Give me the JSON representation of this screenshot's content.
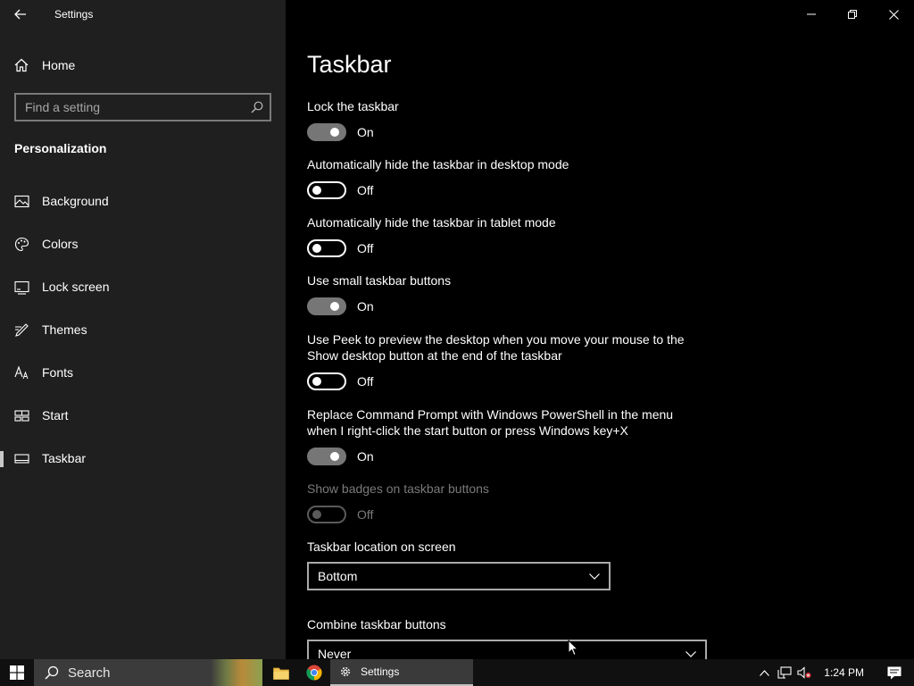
{
  "window": {
    "title": "Settings"
  },
  "sidebar": {
    "home_label": "Home",
    "search_placeholder": "Find a setting",
    "section_title": "Personalization",
    "items": [
      {
        "label": "Background",
        "icon": "image-icon"
      },
      {
        "label": "Colors",
        "icon": "palette-icon"
      },
      {
        "label": "Lock screen",
        "icon": "lock-screen-icon"
      },
      {
        "label": "Themes",
        "icon": "themes-brush-icon"
      },
      {
        "label": "Fonts",
        "icon": "fonts-icon"
      },
      {
        "label": "Start",
        "icon": "start-tiles-icon"
      },
      {
        "label": "Taskbar",
        "icon": "taskbar-icon",
        "selected": true
      }
    ]
  },
  "main": {
    "title": "Taskbar",
    "settings": [
      {
        "label": "Lock the taskbar",
        "state": "On"
      },
      {
        "label": "Automatically hide the taskbar in desktop mode",
        "state": "Off"
      },
      {
        "label": "Automatically hide the taskbar in tablet mode",
        "state": "Off"
      },
      {
        "label": "Use small taskbar buttons",
        "state": "On"
      },
      {
        "label": "Use Peek to preview the desktop when you move your mouse to the Show desktop button at the end of the taskbar",
        "state": "Off"
      },
      {
        "label": "Replace Command Prompt with Windows PowerShell in the menu when I right-click the start button or press Windows key+X",
        "state": "On"
      },
      {
        "label": "Show badges on taskbar buttons",
        "state": "Off",
        "disabled": true
      }
    ],
    "location": {
      "label": "Taskbar location on screen",
      "value": "Bottom"
    },
    "combine": {
      "label": "Combine taskbar buttons",
      "value": "Never"
    }
  },
  "taskbar": {
    "search_label": "Search",
    "settings_app_label": "Settings",
    "clock": "1:24 PM"
  },
  "colors": {
    "sidebar_bg": "#1f1f1f",
    "main_bg": "#000000",
    "toggle_on": "#767676",
    "disabled_text": "#7a7a7a"
  }
}
